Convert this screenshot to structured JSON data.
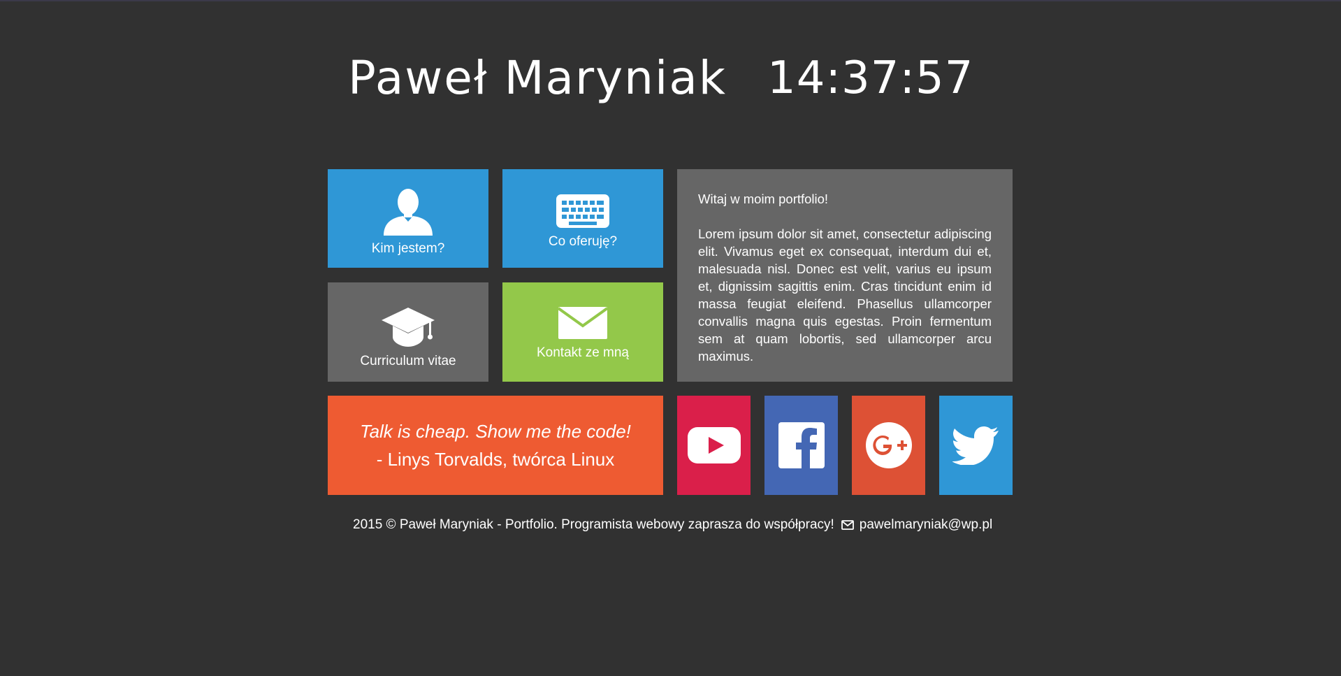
{
  "header": {
    "name": "Paweł Maryniak",
    "clock": "14:37:57"
  },
  "tiles": {
    "about": {
      "label": "Kim jestem?",
      "icon": "user-icon"
    },
    "offer": {
      "label": "Co oferuję?",
      "icon": "keyboard-icon"
    },
    "cv": {
      "label": "Curriculum vitae",
      "icon": "graduation-cap-icon"
    },
    "contact": {
      "label": "Kontakt ze mną",
      "icon": "envelope-icon"
    }
  },
  "welcome": {
    "heading": "Witaj w moim portfolio!",
    "body": "Lorem ipsum dolor sit amet, consectetur adipiscing elit. Vivamus eget ex consequat, interdum dui et, malesuada nisl. Donec est velit, varius eu ipsum et, dignissim sagittis enim. Cras tincidunt enim id massa feugiat eleifend. Phasellus ullamcorper convallis magna quis egestas. Proin fermentum sem at quam lobortis, sed ullamcorper arcu maximus."
  },
  "quote": {
    "text": "Talk is cheap. Show me the code!",
    "author": "- Linys Torvalds, twórca Linux"
  },
  "social": [
    {
      "name": "youtube",
      "icon": "youtube-icon"
    },
    {
      "name": "facebook",
      "icon": "facebook-icon"
    },
    {
      "name": "google-plus",
      "icon": "google-plus-icon"
    },
    {
      "name": "twitter",
      "icon": "twitter-icon"
    }
  ],
  "footer": {
    "text": "2015 © Paweł Maryniak - Portfolio. Programista webowy zaprasza do współpracy!",
    "email": "pawelmaryniak@wp.pl"
  },
  "colors": {
    "background": "#313131",
    "blue": "#2f97d6",
    "gray": "#666666",
    "green": "#93c84a",
    "orange": "#ee5b32",
    "youtube": "#da1f4a",
    "facebook": "#4467b4",
    "google_plus": "#dd5135",
    "twitter": "#2f97d6"
  }
}
